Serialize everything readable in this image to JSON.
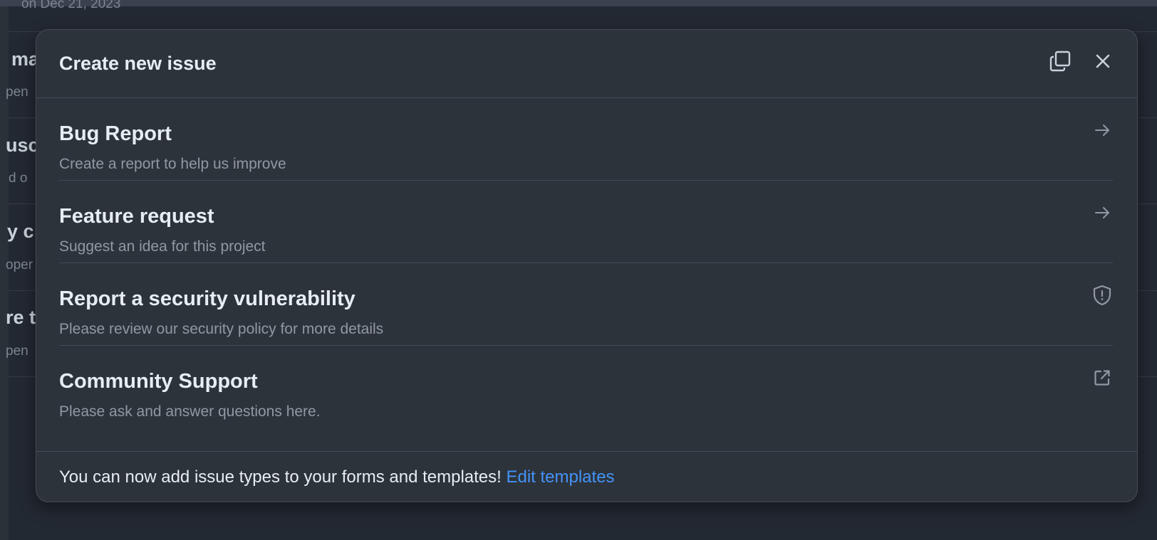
{
  "background": {
    "rows": [
      {
        "title": "",
        "sub": "on Dec 21, 2023"
      },
      {
        "title": "ma",
        "sub": "pen"
      },
      {
        "title": "usc",
        "sub": "d o"
      },
      {
        "title": "y c",
        "sub": "oper"
      },
      {
        "title": "re t",
        "sub": "pen"
      }
    ]
  },
  "modal": {
    "title": "Create new issue",
    "copy_icon": "copy-icon",
    "close_icon": "close-icon",
    "items": [
      {
        "title": "Bug Report",
        "description": "Create a report to help us improve",
        "icon": "arrow-right-icon"
      },
      {
        "title": "Feature request",
        "description": "Suggest an idea for this project",
        "icon": "arrow-right-icon"
      },
      {
        "title": "Report a security vulnerability",
        "description": "Please review our security policy for more details",
        "icon": "shield-alert-icon"
      },
      {
        "title": "Community Support",
        "description": "Please ask and answer questions here.",
        "icon": "external-link-icon"
      }
    ],
    "footer": {
      "text": "You can now add issue types to your forms and templates! ",
      "link": "Edit templates"
    }
  },
  "colors": {
    "modal_bg": "#2d333b",
    "border": "#444c56",
    "link": "#4493f8",
    "text_primary": "#e6edf3",
    "text_muted": "#9198a1"
  }
}
